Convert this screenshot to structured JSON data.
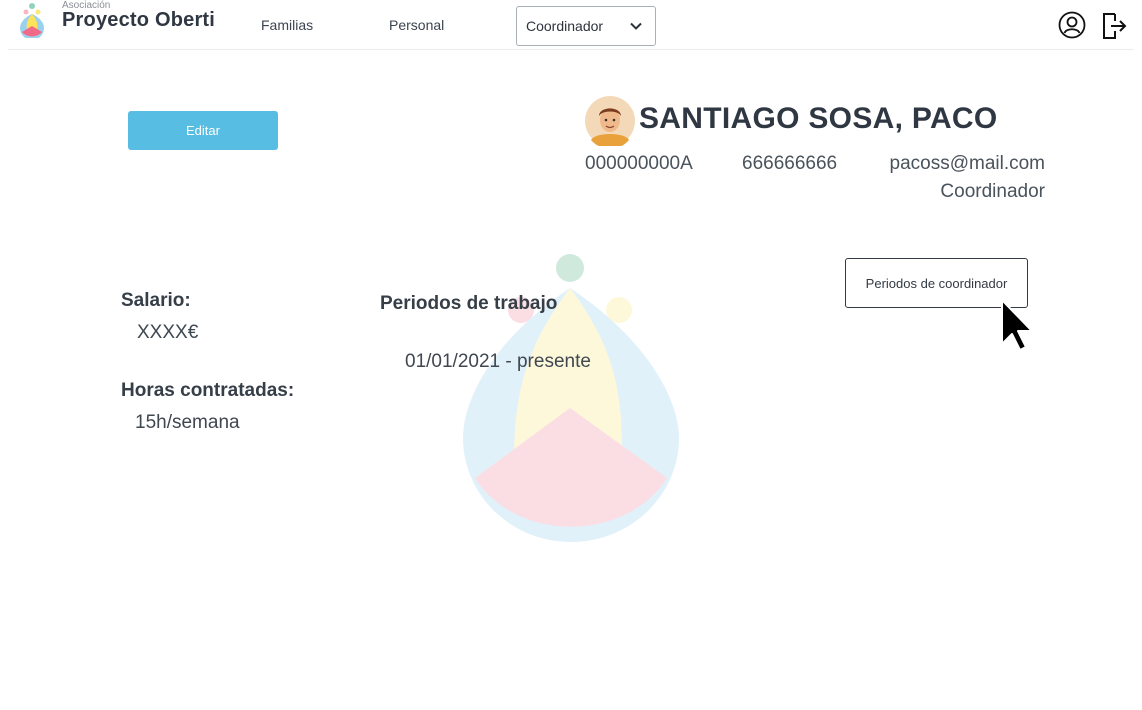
{
  "brand": {
    "small": "Asociación",
    "name": "Proyecto Oberti"
  },
  "nav": {
    "familias": "Familias",
    "personal": "Personal",
    "role_select": {
      "value": "Coordinador"
    }
  },
  "icons": {
    "logo": "oberti-logo-icon",
    "chevron": "chevron-down-icon",
    "user": "user-circle-icon",
    "logout": "logout-icon",
    "avatar": "avatar",
    "cursor": "mouse-pointer-icon"
  },
  "colors": {
    "primary_button": "#57bde2",
    "text_dark": "#2f3742"
  },
  "actions": {
    "edit": "Editar",
    "periods": "Periodos de coordinador"
  },
  "profile": {
    "name": "SANTIAGO SOSA, PACO",
    "id": "000000000A",
    "phone": "666666666",
    "email": "pacoss@mail.com",
    "role": "Coordinador"
  },
  "details": {
    "salario_label": "Salario:",
    "salario_value": "XXXX€",
    "horas_label": "Horas contratadas:",
    "horas_value": "15h/semana",
    "periodos_label": "Periodos de trabajo",
    "periodos": [
      "01/01/2021 - presente"
    ]
  }
}
